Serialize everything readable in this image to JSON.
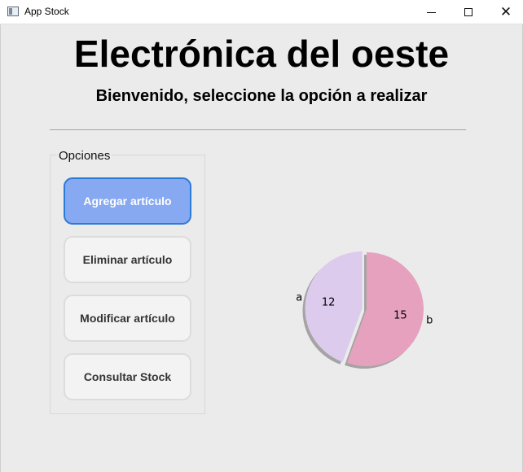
{
  "window": {
    "title": "App Stock",
    "minimize_symbol": "",
    "maximize_symbol": "",
    "close_symbol": "✕"
  },
  "header": {
    "title": "Electrónica del oeste",
    "subtitle": "Bienvenido, seleccione la opción a realizar"
  },
  "options": {
    "group_title": "Opciones",
    "buttons": [
      {
        "label": "Agregar artículo",
        "active": true
      },
      {
        "label": "Eliminar artículo",
        "active": false
      },
      {
        "label": "Modificar artículo",
        "active": false
      },
      {
        "label": "Consultar Stock",
        "active": false
      }
    ]
  },
  "chart_data": {
    "type": "pie",
    "shadow": true,
    "explode": [
      0.08,
      0.0
    ],
    "slices": [
      {
        "label": "a",
        "value": 12,
        "value_label": "12",
        "color": "#dccbec"
      },
      {
        "label": "b",
        "value": 15,
        "value_label": "15",
        "color": "#e6a1be"
      }
    ]
  },
  "colors": {
    "active_button_bg": "#87a9f1",
    "active_button_border": "#2b7bd6"
  }
}
